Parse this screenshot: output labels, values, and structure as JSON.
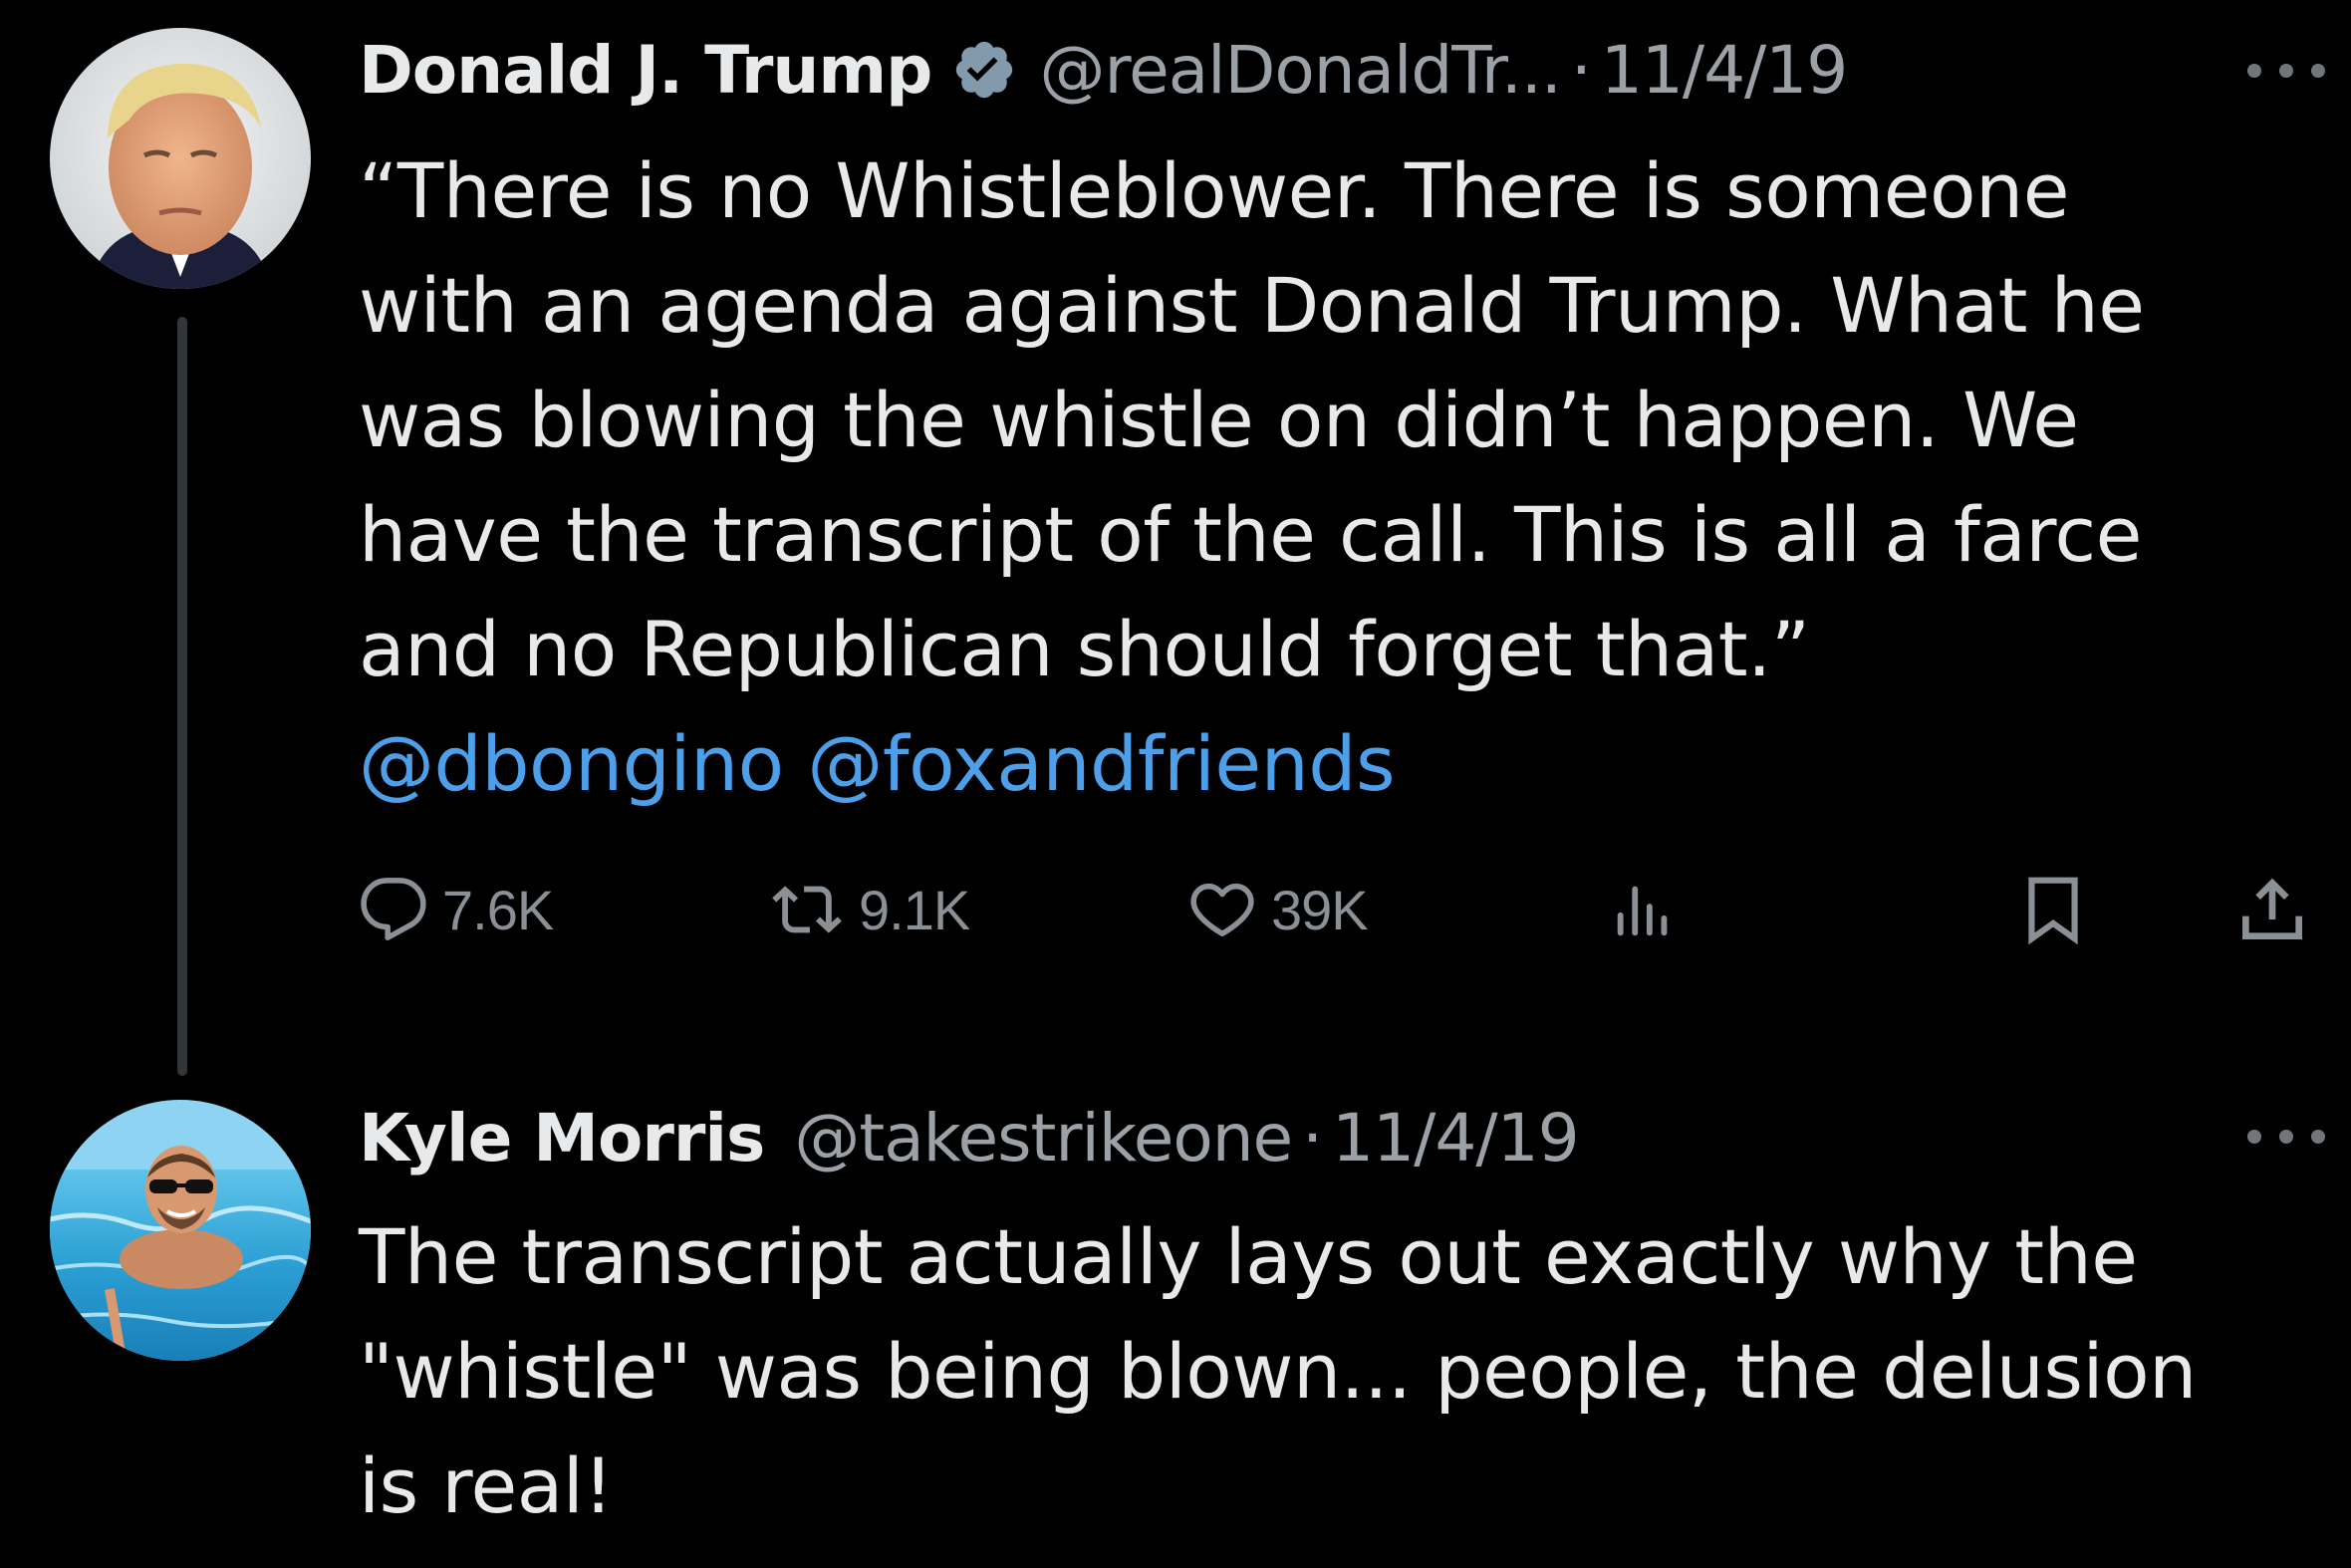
{
  "tweet1": {
    "name": "Donald J. Trump",
    "handle": "@realDonaldTr...",
    "separator": "·",
    "date": "11/4/19",
    "text_lines": [
      "“There is no Whistleblower. There is someone",
      "with an agenda against Donald Trump. What he",
      "was blowing the whistle on didn’t happen. We",
      "have the transcript of the call. This is all a farce",
      "and no Republican should forget that.”"
    ],
    "mentions": [
      "@dbongino",
      "@foxandfriends"
    ],
    "stats": {
      "replies": "7.6K",
      "retweets": "9.1K",
      "likes": "39K"
    }
  },
  "tweet2": {
    "name": "Kyle Morris",
    "handle": "@takestrikeone",
    "separator": "·",
    "date": "11/4/19",
    "text_lines": [
      "The transcript actually lays out exactly why the",
      "\"whistle\" was being blown... people, the delusion",
      "is real!"
    ]
  },
  "icons": {
    "verified": "verified-badge-icon",
    "more": "more-options-icon",
    "reply": "reply-icon",
    "retweet": "retweet-icon",
    "like": "heart-icon",
    "views": "analytics-icon",
    "bookmark": "bookmark-icon",
    "share": "share-icon"
  },
  "colors": {
    "background": "#000000",
    "text": "#e7e9ea",
    "secondary": "#9ba1a6",
    "mention": "#4c9fe8",
    "thread_line": "#333639"
  }
}
